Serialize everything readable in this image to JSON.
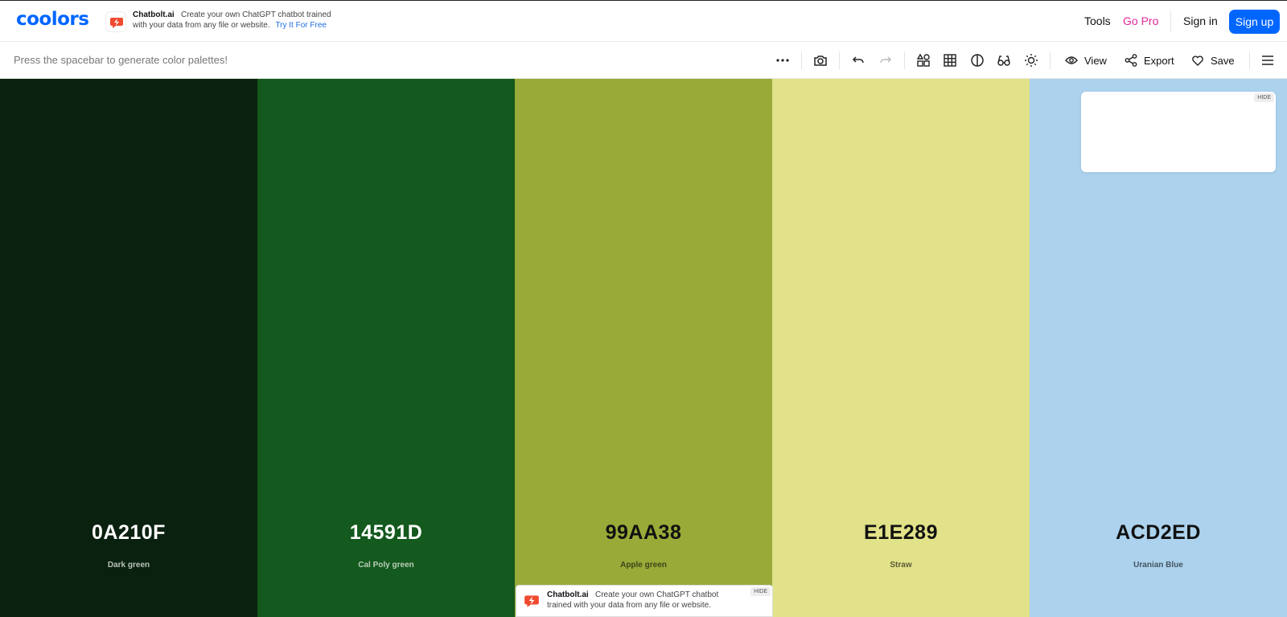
{
  "header": {
    "logo": "coolors",
    "ad": {
      "name": "Chatbolt.ai",
      "text_line1": "Create your own ChatGPT chatbot trained",
      "text_line2": "with your data from any file or website.",
      "cta": "Try It For Free"
    },
    "nav": {
      "tools": "Tools",
      "go_pro": "Go Pro",
      "sign_in": "Sign in",
      "sign_up": "Sign up"
    }
  },
  "toolbar": {
    "hint": "Press the spacebar to generate color palettes!",
    "icons": [
      "more-icon",
      "camera-icon",
      "undo-icon",
      "redo-icon",
      "shapes-icon",
      "grid-icon",
      "contrast-icon",
      "glasses-icon",
      "sun-icon"
    ],
    "view_label": "View",
    "export_label": "Export",
    "save_label": "Save"
  },
  "palette": [
    {
      "hex": "0A210F",
      "name": "Dark green",
      "color": "#0A210F",
      "text_color": "#ffffff",
      "name_color": "#b8c2ba"
    },
    {
      "hex": "14591D",
      "name": "Cal Poly green",
      "color": "#14591D",
      "text_color": "#ffffff",
      "name_color": "#b9cdbb"
    },
    {
      "hex": "99AA38",
      "name": "Apple green",
      "color": "#99AA38",
      "text_color": "#111111",
      "name_color": "#3e451a"
    },
    {
      "hex": "E1E289",
      "name": "Straw",
      "color": "#E1E289",
      "text_color": "#111111",
      "name_color": "#5b5b37"
    },
    {
      "hex": "ACD2ED",
      "name": "Uranian Blue",
      "color": "#ACD2ED",
      "text_color": "#111111",
      "name_color": "#45545f"
    }
  ],
  "top_card": {
    "hide_label": "HIDE"
  },
  "bottom_ad": {
    "name": "Chatbolt.ai",
    "text_line1": "Create your own ChatGPT chatbot",
    "text_line2": "trained with your data from any file or website.",
    "hide_label": "HIDE"
  }
}
